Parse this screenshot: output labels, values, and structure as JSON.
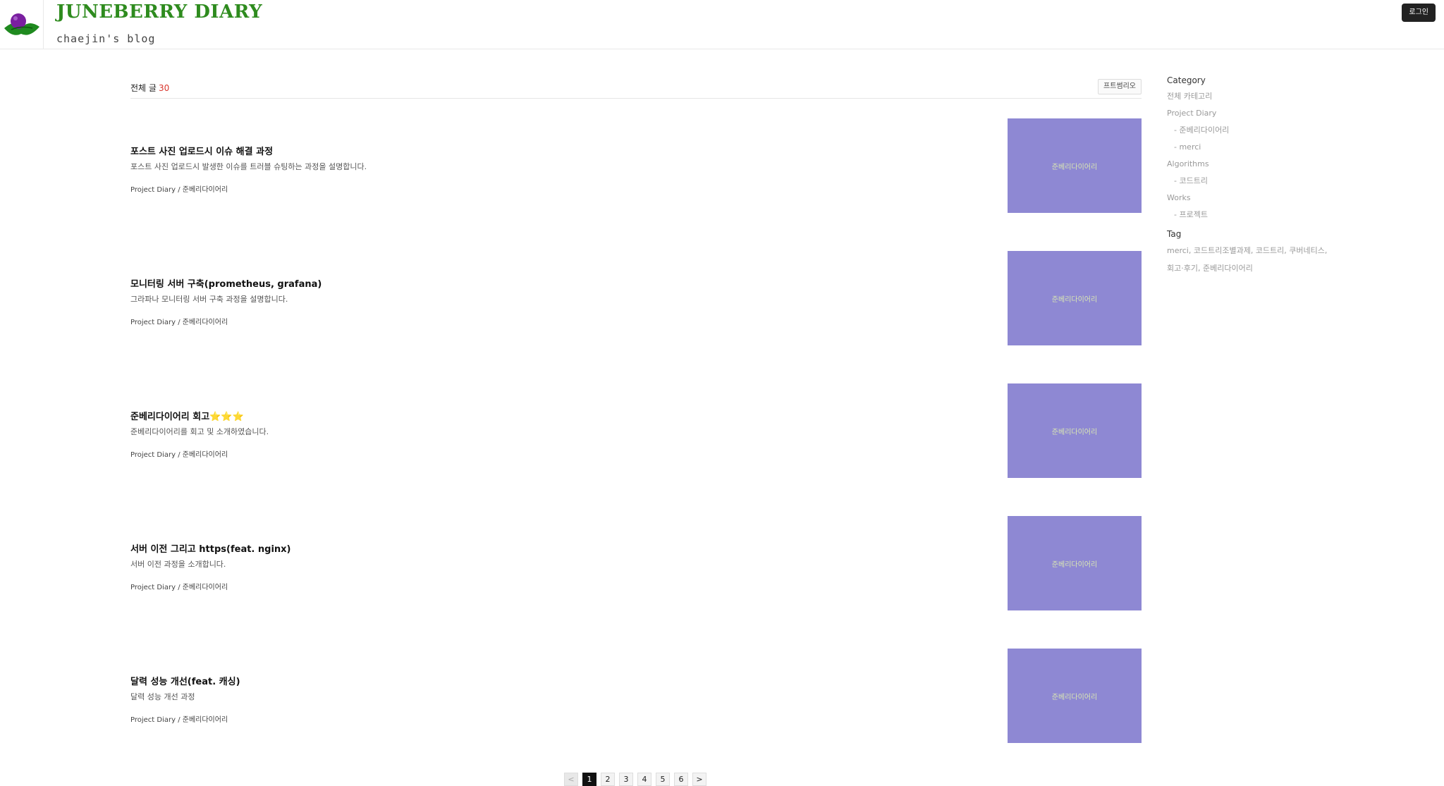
{
  "header": {
    "title": "JUNEBERRY DIARY",
    "subtitle": "chaejin's blog",
    "login_label": "로그인",
    "logo_icon": "berry-leaf-icon",
    "accent_color": "#2e8b1e"
  },
  "list": {
    "total_label": "전체 글",
    "total_count": "30",
    "view_toggle_label": "프트썸리오"
  },
  "posts": [
    {
      "title": "포스트 사진 업로드시 이슈 해결 과정",
      "summary": "포스트 사진 업로드시 발생한 이슈를 트러블 슈팅하는 과정을 설명합니다.",
      "meta": "Project Diary / 준베리다이어리",
      "thumb_text": "준베리다이어리"
    },
    {
      "title": "모니터링 서버 구축(prometheus, grafana)",
      "summary": "그라파나 모니터링 서버 구축 과정을 설명합니다.",
      "meta": "Project Diary / 준베리다이어리",
      "thumb_text": "준베리다이어리"
    },
    {
      "title": "준베리다이어리 회고⭐⭐⭐",
      "summary": "준베리다이어리를 회고 및 소개하였습니다.",
      "meta": "Project Diary / 준베리다이어리",
      "thumb_text": "준베리다이어리"
    },
    {
      "title": "서버 이전 그리고 https(feat. nginx)",
      "summary": "서버 이전 과정을 소개합니다.",
      "meta": "Project Diary / 준베리다이어리",
      "thumb_text": "준베리다이어리"
    },
    {
      "title": "달력 성능 개선(feat. 캐싱)",
      "summary": "달력 성능 개선 과정",
      "meta": "Project Diary / 준베리다이어리",
      "thumb_text": "준베리다이어리"
    }
  ],
  "pagination": {
    "prev": "<",
    "next": ">",
    "pages": [
      "1",
      "2",
      "3",
      "4",
      "5",
      "6"
    ],
    "current": "1"
  },
  "sidebar": {
    "category_heading": "Category",
    "all_label": "전체 카테고리",
    "groups": [
      {
        "name": "Project Diary",
        "items": [
          "- 준베리다이어리",
          "- merci"
        ]
      },
      {
        "name": "Algorithms",
        "items": [
          "- 코드트리"
        ]
      },
      {
        "name": "Works",
        "items": [
          "- 프로젝트"
        ]
      }
    ],
    "tag_heading": "Tag",
    "tags": "merci, 코드트리조별과제, 코드트리, 쿠버네티스, 회고·후기, 준베리다이어리"
  }
}
